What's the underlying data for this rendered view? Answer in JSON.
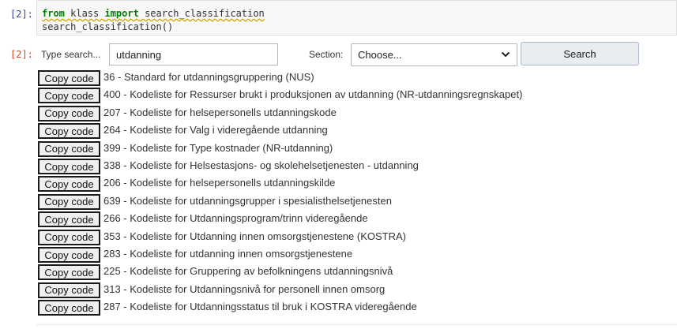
{
  "input_cell": {
    "prompt": "[2]:",
    "code_line1": {
      "kw1": "from",
      "module": " klass ",
      "kw2": "import",
      "name": " search_classification"
    },
    "code_line2": "search_classification()"
  },
  "output_cell": {
    "prompt": "[2]:",
    "search_label": "Type search...",
    "search_value": "utdanning",
    "section_label": "Section:",
    "section_selected": "Choose...",
    "search_button": "Search",
    "copy_label": "Copy code",
    "results": [
      "36 - Standard for utdanningsgruppering (NUS)",
      "400 - Kodeliste for Ressurser brukt i produksjonen av utdanning (NR-utdanningsregnskapet)",
      "207 - Kodeliste for helsepersonells utdanningskode",
      "264 - Kodeliste for Valg i videregående utdanning",
      "399 - Kodeliste for Type kostnader (NR-utdanning)",
      "338 - Kodeliste for Helsestasjons- og skolehelsetjenesten - utdanning",
      "206 - Kodeliste for helsepersonells utdanningskilde",
      "639 - Kodeliste for utdanningsgrupper i spesialisthelsetjenesten",
      "266 - Kodeliste for Utdanningsprogram/trinn videregående",
      "353 - Kodeliste for Utdanning innen omsorgstjenestene (KOSTRA)",
      "283 - Kodeliste for utdanning innen omsorgstjenestene",
      "225 - Kodeliste for Gruppering av befolkningens utdanningsnivå",
      "313 - Kodeliste for Utdanningsnivå for personell innen omsorg",
      "287 - Kodeliste for Utdanningsstatus til bruk i KOSTRA videregående"
    ]
  },
  "colors": {
    "in_prompt": "#303f9f",
    "out_prompt": "#d84315",
    "keyword": "#008000"
  },
  "icons": {
    "select_arrow": "chevron-down-icon"
  }
}
